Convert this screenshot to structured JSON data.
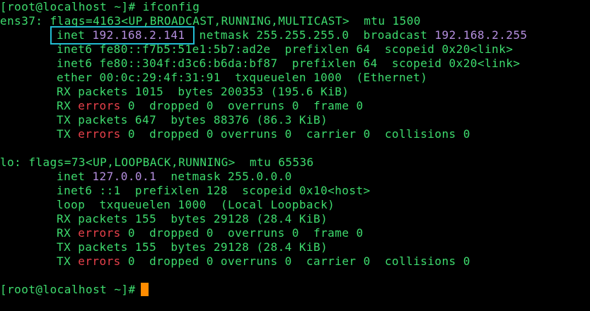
{
  "window": {
    "cursor_color": "#ff8c00",
    "highlight_color": "#22bcd2"
  },
  "prompt": {
    "user_host_dir": "[root@localhost ~]#",
    "command": " ifconfig"
  },
  "ens37": {
    "header": "ens37: flags=4163<UP,BROADCAST,RUNNING,MULTICAST>  mtu 1500",
    "inet_label": "inet ",
    "inet_addr": "192.168.2.141",
    "inet_rest": "  netmask 255.255.255.0  broadcast ",
    "broadcast_addr": "192.168.2.255",
    "inet6_1": "inet6 fe80::f7b5:51e1:5b7:ad2e  prefixlen 64  scopeid 0x20<link>",
    "inet6_2": "inet6 fe80::304f:d3c6:b6da:bf87  prefixlen 64  scopeid 0x20<link>",
    "ether": "ether 00:0c:29:4f:31:91  txqueuelen 1000  (Ethernet)",
    "rx_packets": "RX packets 1015  bytes 200353 (195.6 KiB)",
    "rx_err_label": "RX ",
    "rx_err_word": "errors",
    "rx_err_rest": " 0  dropped 0  overruns 0  frame 0",
    "tx_packets": "TX packets 647  bytes 88376 (86.3 KiB)",
    "tx_err_label": "TX ",
    "tx_err_word": "errors",
    "tx_err_rest": " 0  dropped 0 overruns 0  carrier 0  collisions 0"
  },
  "lo": {
    "header": "lo: flags=73<UP,LOOPBACK,RUNNING>  mtu 65536",
    "inet_label": "inet ",
    "inet_addr": "127.0.0.1",
    "inet_rest": "  netmask 255.0.0.0",
    "inet6": "inet6 ::1  prefixlen 128  scopeid 0x10<host>",
    "loop": "loop  txqueuelen 1000  (Local Loopback)",
    "rx_packets": "RX packets 155  bytes 29128 (28.4 KiB)",
    "rx_err_label": "RX ",
    "rx_err_word": "errors",
    "rx_err_rest": " 0  dropped 0  overruns 0  frame 0",
    "tx_packets": "TX packets 155  bytes 29128 (28.4 KiB)",
    "tx_err_label": "TX ",
    "tx_err_word": "errors",
    "tx_err_rest": " 0  dropped 0 overruns 0  carrier 0  collisions 0"
  },
  "prompt2": {
    "user_host_dir": "[root@localhost ~]#",
    "command": " "
  }
}
